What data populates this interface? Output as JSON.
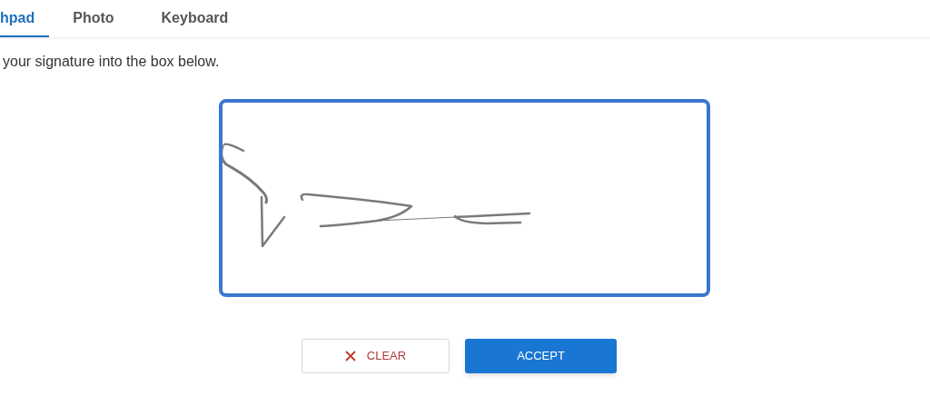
{
  "tabs": [
    {
      "label": "hpad",
      "selected": true
    },
    {
      "label": "Photo",
      "selected": false
    },
    {
      "label": "Keyboard",
      "selected": false
    }
  ],
  "instruction": "your signature into the box below.",
  "buttons": [
    {
      "label": "CLEAR",
      "kind": "clear"
    },
    {
      "label": "ACCEPT",
      "kind": "accept"
    }
  ]
}
